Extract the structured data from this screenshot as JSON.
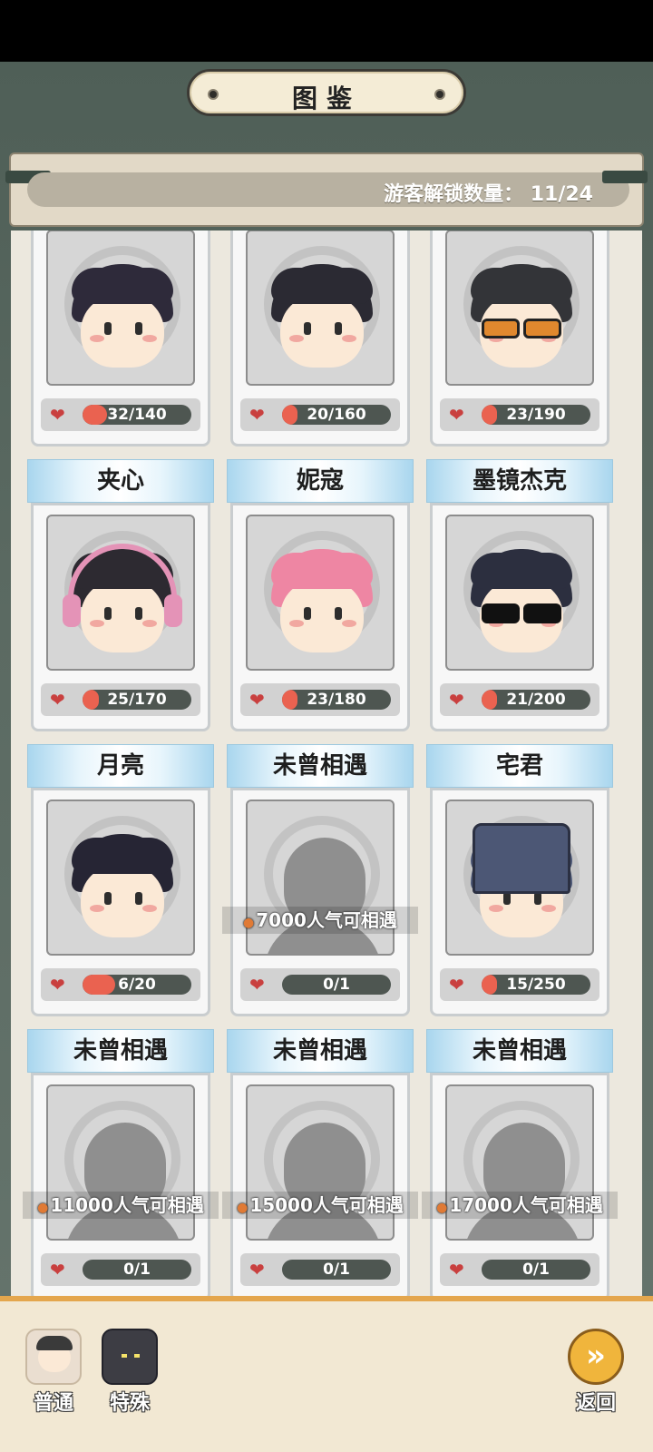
{
  "title": "图鉴",
  "unlock": {
    "label": "游客解锁数量：",
    "value": "11/24",
    "text": "游客解锁数量：  11/24"
  },
  "colors": {
    "progress_fill": "#ea6250",
    "progress_track": "#4e5651",
    "card_header": "#a9d6ee",
    "heart": "#c9403f"
  },
  "cards": [
    {
      "name": "",
      "progress": "32/140",
      "fraction": 0.229,
      "locked": false,
      "hair": "#2e2a3a",
      "acc": "none"
    },
    {
      "name": "",
      "progress": "20/160",
      "fraction": 0.125,
      "locked": false,
      "hair": "#2b2a33",
      "acc": "none"
    },
    {
      "name": "",
      "progress": "23/190",
      "fraction": 0.121,
      "locked": false,
      "hair": "#333438",
      "acc": "orange-glasses"
    },
    {
      "name": "夹心",
      "progress": "25/170",
      "fraction": 0.147,
      "locked": false,
      "hair": "#2d2a31",
      "acc": "headphones"
    },
    {
      "name": "妮寇",
      "progress": "23/180",
      "fraction": 0.128,
      "locked": false,
      "hair": "#ee86a3",
      "acc": "none"
    },
    {
      "name": "墨镜杰克",
      "progress": "21/200",
      "fraction": 0.105,
      "locked": false,
      "hair": "#2c2f3f",
      "acc": "black-glasses"
    },
    {
      "name": "月亮",
      "progress": "6/20",
      "fraction": 0.3,
      "locked": false,
      "hair": "#262534",
      "acc": "none"
    },
    {
      "name": "未曾相遇",
      "progress": "0/1",
      "fraction": 0,
      "locked": true,
      "requirement": "7000人气可相遇"
    },
    {
      "name": "宅君",
      "progress": "15/250",
      "fraction": 0.06,
      "locked": false,
      "hair": "#4c5775",
      "acc": "helmet"
    },
    {
      "name": "未曾相遇",
      "progress": "0/1",
      "fraction": 0,
      "locked": true,
      "requirement": "11000人气可相遇"
    },
    {
      "name": "未曾相遇",
      "progress": "0/1",
      "fraction": 0,
      "locked": true,
      "requirement": "15000人气可相遇"
    },
    {
      "name": "未曾相遇",
      "progress": "0/1",
      "fraction": 0,
      "locked": true,
      "requirement": "17000人气可相遇"
    }
  ],
  "nav": {
    "normal": {
      "label": "普通",
      "icon": "visitor-avatar-icon"
    },
    "special": {
      "label": "特殊",
      "icon": "hooded-figure-icon"
    },
    "back": {
      "label": "返回",
      "icon": "back-arrow-icon",
      "glyph": "»"
    }
  }
}
